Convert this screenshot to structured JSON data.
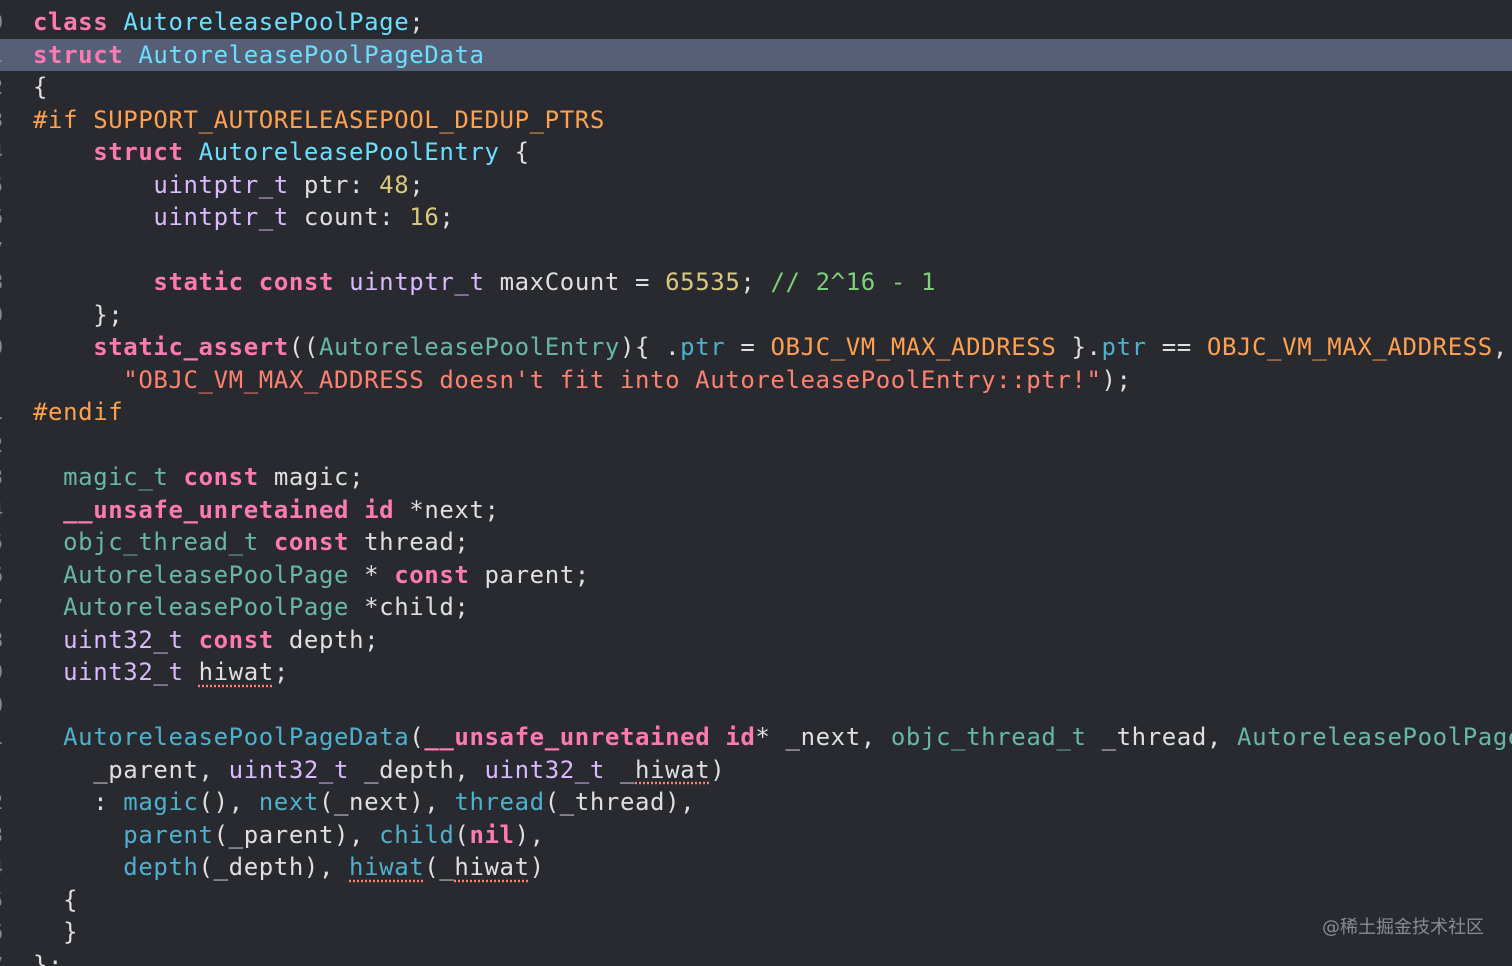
{
  "editor": {
    "gutter": [
      "0",
      "1",
      "2",
      "3",
      "4",
      "5",
      "6",
      "7",
      "8",
      "9",
      "0",
      "",
      "1",
      "2",
      "3",
      "4",
      "5",
      "6",
      "7",
      "8",
      "9",
      "0",
      "1",
      "",
      "2",
      "3",
      "4",
      "5",
      "6",
      "7"
    ],
    "highlighted_line": "struct AutoreleasePoolPageData"
  },
  "lines": [
    [
      {
        "t": "class",
        "c": "kw"
      },
      {
        "t": " ",
        "c": "tx"
      },
      {
        "t": "AutoreleasePoolPage",
        "c": "cl"
      },
      {
        "t": ";",
        "c": "tx"
      }
    ],
    [
      {
        "t": "struct",
        "c": "kw"
      },
      {
        "t": " ",
        "c": "tx"
      },
      {
        "t": "AutoreleasePoolPageData",
        "c": "cl"
      }
    ],
    [
      {
        "t": "{",
        "c": "tx"
      }
    ],
    [
      {
        "t": "#if SUPPORT_AUTORELEASEPOOL_DEDUP_PTRS",
        "c": "mc"
      }
    ],
    [
      {
        "t": "    ",
        "c": "tx"
      },
      {
        "t": "struct",
        "c": "kw"
      },
      {
        "t": " ",
        "c": "tx"
      },
      {
        "t": "AutoreleasePoolEntry",
        "c": "cl"
      },
      {
        "t": " {",
        "c": "tx"
      }
    ],
    [
      {
        "t": "        ",
        "c": "tx"
      },
      {
        "t": "uintptr_t",
        "c": "ty"
      },
      {
        "t": " ptr: ",
        "c": "tx"
      },
      {
        "t": "48",
        "c": "nm"
      },
      {
        "t": ";",
        "c": "tx"
      }
    ],
    [
      {
        "t": "        ",
        "c": "tx"
      },
      {
        "t": "uintptr_t",
        "c": "ty"
      },
      {
        "t": " count: ",
        "c": "tx"
      },
      {
        "t": "16",
        "c": "nm"
      },
      {
        "t": ";",
        "c": "tx"
      }
    ],
    [],
    [
      {
        "t": "        ",
        "c": "tx"
      },
      {
        "t": "static",
        "c": "kw"
      },
      {
        "t": " ",
        "c": "tx"
      },
      {
        "t": "const",
        "c": "kw"
      },
      {
        "t": " ",
        "c": "tx"
      },
      {
        "t": "uintptr_t",
        "c": "ty"
      },
      {
        "t": " maxCount = ",
        "c": "tx"
      },
      {
        "t": "65535",
        "c": "nm"
      },
      {
        "t": "; ",
        "c": "tx"
      },
      {
        "t": "// 2^16 - 1",
        "c": "cm"
      }
    ],
    [
      {
        "t": "    };",
        "c": "tx"
      }
    ],
    [
      {
        "t": "    ",
        "c": "tx"
      },
      {
        "t": "static_assert",
        "c": "kw"
      },
      {
        "t": "((",
        "c": "tx"
      },
      {
        "t": "AutoreleasePoolEntry",
        "c": "pt"
      },
      {
        "t": "){ .",
        "c": "tx"
      },
      {
        "t": "ptr",
        "c": "fn"
      },
      {
        "t": " = ",
        "c": "tx"
      },
      {
        "t": "OBJC_VM_MAX_ADDRESS",
        "c": "mc"
      },
      {
        "t": " }.",
        "c": "tx"
      },
      {
        "t": "ptr",
        "c": "fn"
      },
      {
        "t": " == ",
        "c": "tx"
      },
      {
        "t": "OBJC_VM_MAX_ADDRESS",
        "c": "mc"
      },
      {
        "t": ",",
        "c": "tx"
      }
    ],
    [
      {
        "t": "      ",
        "c": "tx"
      },
      {
        "t": "\"OBJC_VM_MAX_ADDRESS doesn't fit into AutoreleasePoolEntry::ptr!\"",
        "c": "st"
      },
      {
        "t": ");",
        "c": "tx"
      }
    ],
    [
      {
        "t": "#endif",
        "c": "mc"
      }
    ],
    [],
    [
      {
        "t": "  ",
        "c": "tx"
      },
      {
        "t": "magic_t",
        "c": "pt"
      },
      {
        "t": " ",
        "c": "tx"
      },
      {
        "t": "const",
        "c": "kw"
      },
      {
        "t": " magic;",
        "c": "tx"
      }
    ],
    [
      {
        "t": "  ",
        "c": "tx"
      },
      {
        "t": "__unsafe_unretained",
        "c": "kw"
      },
      {
        "t": " ",
        "c": "tx"
      },
      {
        "t": "id",
        "c": "kw"
      },
      {
        "t": " *next;",
        "c": "tx"
      }
    ],
    [
      {
        "t": "  ",
        "c": "tx"
      },
      {
        "t": "objc_thread_t",
        "c": "pt"
      },
      {
        "t": " ",
        "c": "tx"
      },
      {
        "t": "const",
        "c": "kw"
      },
      {
        "t": " thread;",
        "c": "tx"
      }
    ],
    [
      {
        "t": "  ",
        "c": "tx"
      },
      {
        "t": "AutoreleasePoolPage",
        "c": "pt"
      },
      {
        "t": " * ",
        "c": "tx"
      },
      {
        "t": "const",
        "c": "kw"
      },
      {
        "t": " parent;",
        "c": "tx"
      }
    ],
    [
      {
        "t": "  ",
        "c": "tx"
      },
      {
        "t": "AutoreleasePoolPage",
        "c": "pt"
      },
      {
        "t": " *child;",
        "c": "tx"
      }
    ],
    [
      {
        "t": "  ",
        "c": "tx"
      },
      {
        "t": "uint32_t",
        "c": "ty"
      },
      {
        "t": " ",
        "c": "tx"
      },
      {
        "t": "const",
        "c": "kw"
      },
      {
        "t": " depth;",
        "c": "tx"
      }
    ],
    [
      {
        "t": "  ",
        "c": "tx"
      },
      {
        "t": "uint32_t",
        "c": "ty"
      },
      {
        "t": " ",
        "c": "tx"
      },
      {
        "t": "hiwat",
        "c": "tx",
        "u": true
      },
      {
        "t": ";",
        "c": "tx"
      }
    ],
    [],
    [
      {
        "t": "  ",
        "c": "tx"
      },
      {
        "t": "AutoreleasePoolPageData",
        "c": "fn"
      },
      {
        "t": "(",
        "c": "tx"
      },
      {
        "t": "__unsafe_unretained",
        "c": "kw"
      },
      {
        "t": " ",
        "c": "tx"
      },
      {
        "t": "id",
        "c": "kw"
      },
      {
        "t": "* _next, ",
        "c": "tx"
      },
      {
        "t": "objc_thread_t",
        "c": "pt"
      },
      {
        "t": " _thread, ",
        "c": "tx"
      },
      {
        "t": "AutoreleasePoolPage",
        "c": "pt"
      },
      {
        "t": "*",
        "c": "tx"
      }
    ],
    [
      {
        "t": "    _parent, ",
        "c": "tx"
      },
      {
        "t": "uint32_t",
        "c": "ty"
      },
      {
        "t": " _depth, ",
        "c": "tx"
      },
      {
        "t": "uint32_t",
        "c": "ty"
      },
      {
        "t": " _",
        "c": "tx"
      },
      {
        "t": "hiwat",
        "c": "tx",
        "u": true
      },
      {
        "t": ")",
        "c": "tx"
      }
    ],
    [
      {
        "t": "    : ",
        "c": "tx"
      },
      {
        "t": "magic",
        "c": "fn"
      },
      {
        "t": "(), ",
        "c": "tx"
      },
      {
        "t": "next",
        "c": "fn"
      },
      {
        "t": "(_next), ",
        "c": "tx"
      },
      {
        "t": "thread",
        "c": "fn"
      },
      {
        "t": "(_thread),",
        "c": "tx"
      }
    ],
    [
      {
        "t": "      ",
        "c": "tx"
      },
      {
        "t": "parent",
        "c": "fn"
      },
      {
        "t": "(_parent), ",
        "c": "tx"
      },
      {
        "t": "child",
        "c": "fn"
      },
      {
        "t": "(",
        "c": "tx"
      },
      {
        "t": "nil",
        "c": "kw"
      },
      {
        "t": "),",
        "c": "tx"
      }
    ],
    [
      {
        "t": "      ",
        "c": "tx"
      },
      {
        "t": "depth",
        "c": "fn"
      },
      {
        "t": "(_depth), ",
        "c": "tx"
      },
      {
        "t": "hiwat",
        "c": "fn",
        "u": true
      },
      {
        "t": "(_",
        "c": "tx"
      },
      {
        "t": "hiwat",
        "c": "tx",
        "u": true
      },
      {
        "t": ")",
        "c": "tx"
      }
    ],
    [
      {
        "t": "  {",
        "c": "tx"
      }
    ],
    [
      {
        "t": "  }",
        "c": "tx"
      }
    ],
    [
      {
        "t": "};",
        "c": "tx"
      }
    ]
  ],
  "colors": {
    "background": "#292a30",
    "highlight": "#575f76",
    "keyword": "#ff7ab2",
    "type": "#dabaff",
    "class": "#6bdfff",
    "project_type": "#67b7a4",
    "function": "#4eb0cc",
    "macro": "#ffa14f",
    "string": "#ff8170",
    "number": "#d9c97c",
    "comment": "#7ecf7b",
    "text": "#dfdfe0"
  },
  "watermark": "@稀土掘金技术社区"
}
